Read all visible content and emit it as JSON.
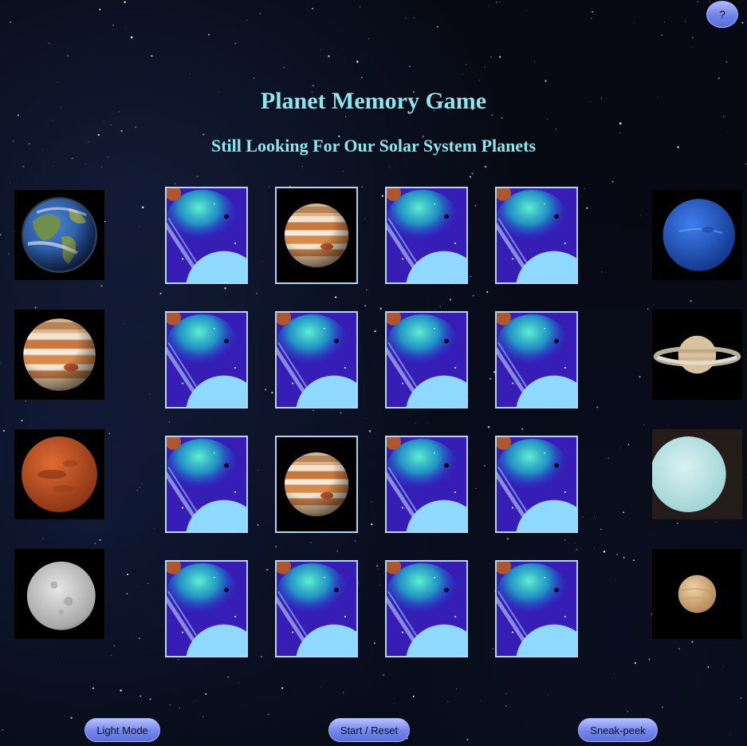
{
  "header": {
    "help_label": "?",
    "title": "Planet Memory Game",
    "status": "Still Looking For Our Solar System Planets"
  },
  "left_planets": [
    "earth",
    "jupiter",
    "mars",
    "mercury"
  ],
  "right_planets": [
    "neptune",
    "saturn",
    "uranus",
    "venus"
  ],
  "board": {
    "rows": 4,
    "cols": 4,
    "cards": [
      "back",
      "jupiter",
      "back",
      "back",
      "back",
      "back",
      "back",
      "back",
      "back",
      "jupiter",
      "back",
      "back",
      "back",
      "back",
      "back",
      "back"
    ]
  },
  "controls": {
    "light_mode_label": "Light Mode",
    "start_reset_label": "Start / Reset",
    "sneak_peek_label": "Sneak-peek"
  },
  "colors": {
    "title": "#8ee6ec",
    "card_border": "#b7d2f2",
    "button_top": "#b7c1ff",
    "button_bottom": "#5c70d8",
    "background": "#070a14"
  }
}
